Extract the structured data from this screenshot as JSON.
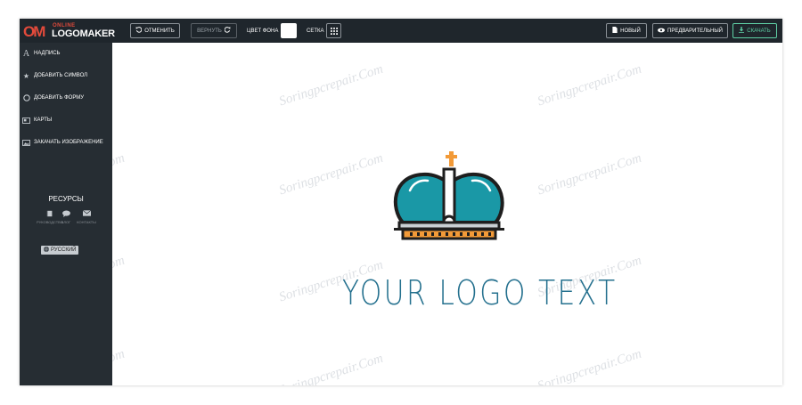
{
  "brand": {
    "mark": "OM",
    "online": "ONLINE",
    "name": "LOGOMAKER"
  },
  "toolbar": {
    "undo_label": "ОТМЕНИТЬ",
    "redo_label": "ВЕРНУТЬ",
    "bg_color_label": "ЦВЕТ ФОНА",
    "bg_color_value": "#ffffff",
    "grid_label": "СЕТКА",
    "new_label": "НОВЫЙ",
    "preview_label": "ПРЕДВАРИТЕЛЬНЫЙ",
    "download_label": "СКАЧАТЬ"
  },
  "sidebar": {
    "items": [
      {
        "label": "НАДПИСЬ",
        "icon": "text-icon"
      },
      {
        "label": "ДОБАВИТЬ СИМВОЛ",
        "icon": "star-icon"
      },
      {
        "label": "ДОБАВИТЬ ФОРМУ",
        "icon": "circle-icon"
      },
      {
        "label": "КАРТЫ",
        "icon": "card-icon"
      },
      {
        "label": "ЗАКАЧАТЬ ИЗОБРАЖЕНИЕ",
        "icon": "image-icon"
      }
    ],
    "resources_title": "РЕСУРСЫ",
    "resources": [
      {
        "label": "РУКОВОДСТВО",
        "icon": "book-icon"
      },
      {
        "label": "БЛОГ",
        "icon": "chat-icon"
      },
      {
        "label": "КОНТАКТЫ",
        "icon": "mail-icon"
      }
    ],
    "language": "РУССКИЙ"
  },
  "canvas": {
    "logo_text": "YOUR LOGO TEXT",
    "logo_colors": {
      "dome": "#1a98a6",
      "outline": "#1e1e1e",
      "cross": "#f29a38",
      "text": "#24708e"
    }
  },
  "watermark": "Soringpcrepair.Com"
}
